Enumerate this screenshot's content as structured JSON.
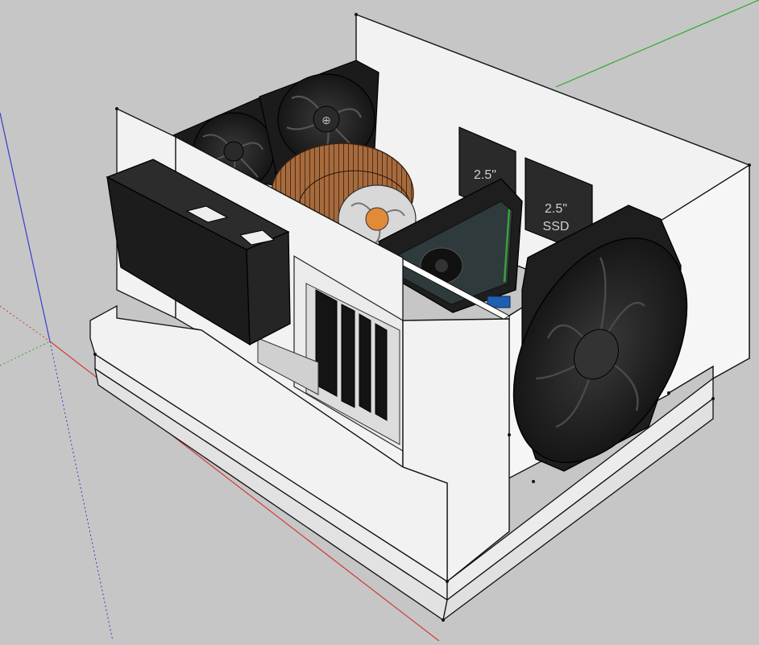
{
  "scene": {
    "background_color": "#c6c6c6",
    "axis_colors": {
      "red": "#d43a3a",
      "green": "#2faa2f",
      "blue": "#3a3ad4"
    },
    "case_color": "#f2f2f2",
    "component_color": "#1e1e1e",
    "heatsink_copper": "#b87a4a",
    "drive_bays": [
      {
        "line1": "2.5\"",
        "line2": ""
      },
      {
        "line1": "2.5\"",
        "line2": "SSD"
      }
    ]
  }
}
